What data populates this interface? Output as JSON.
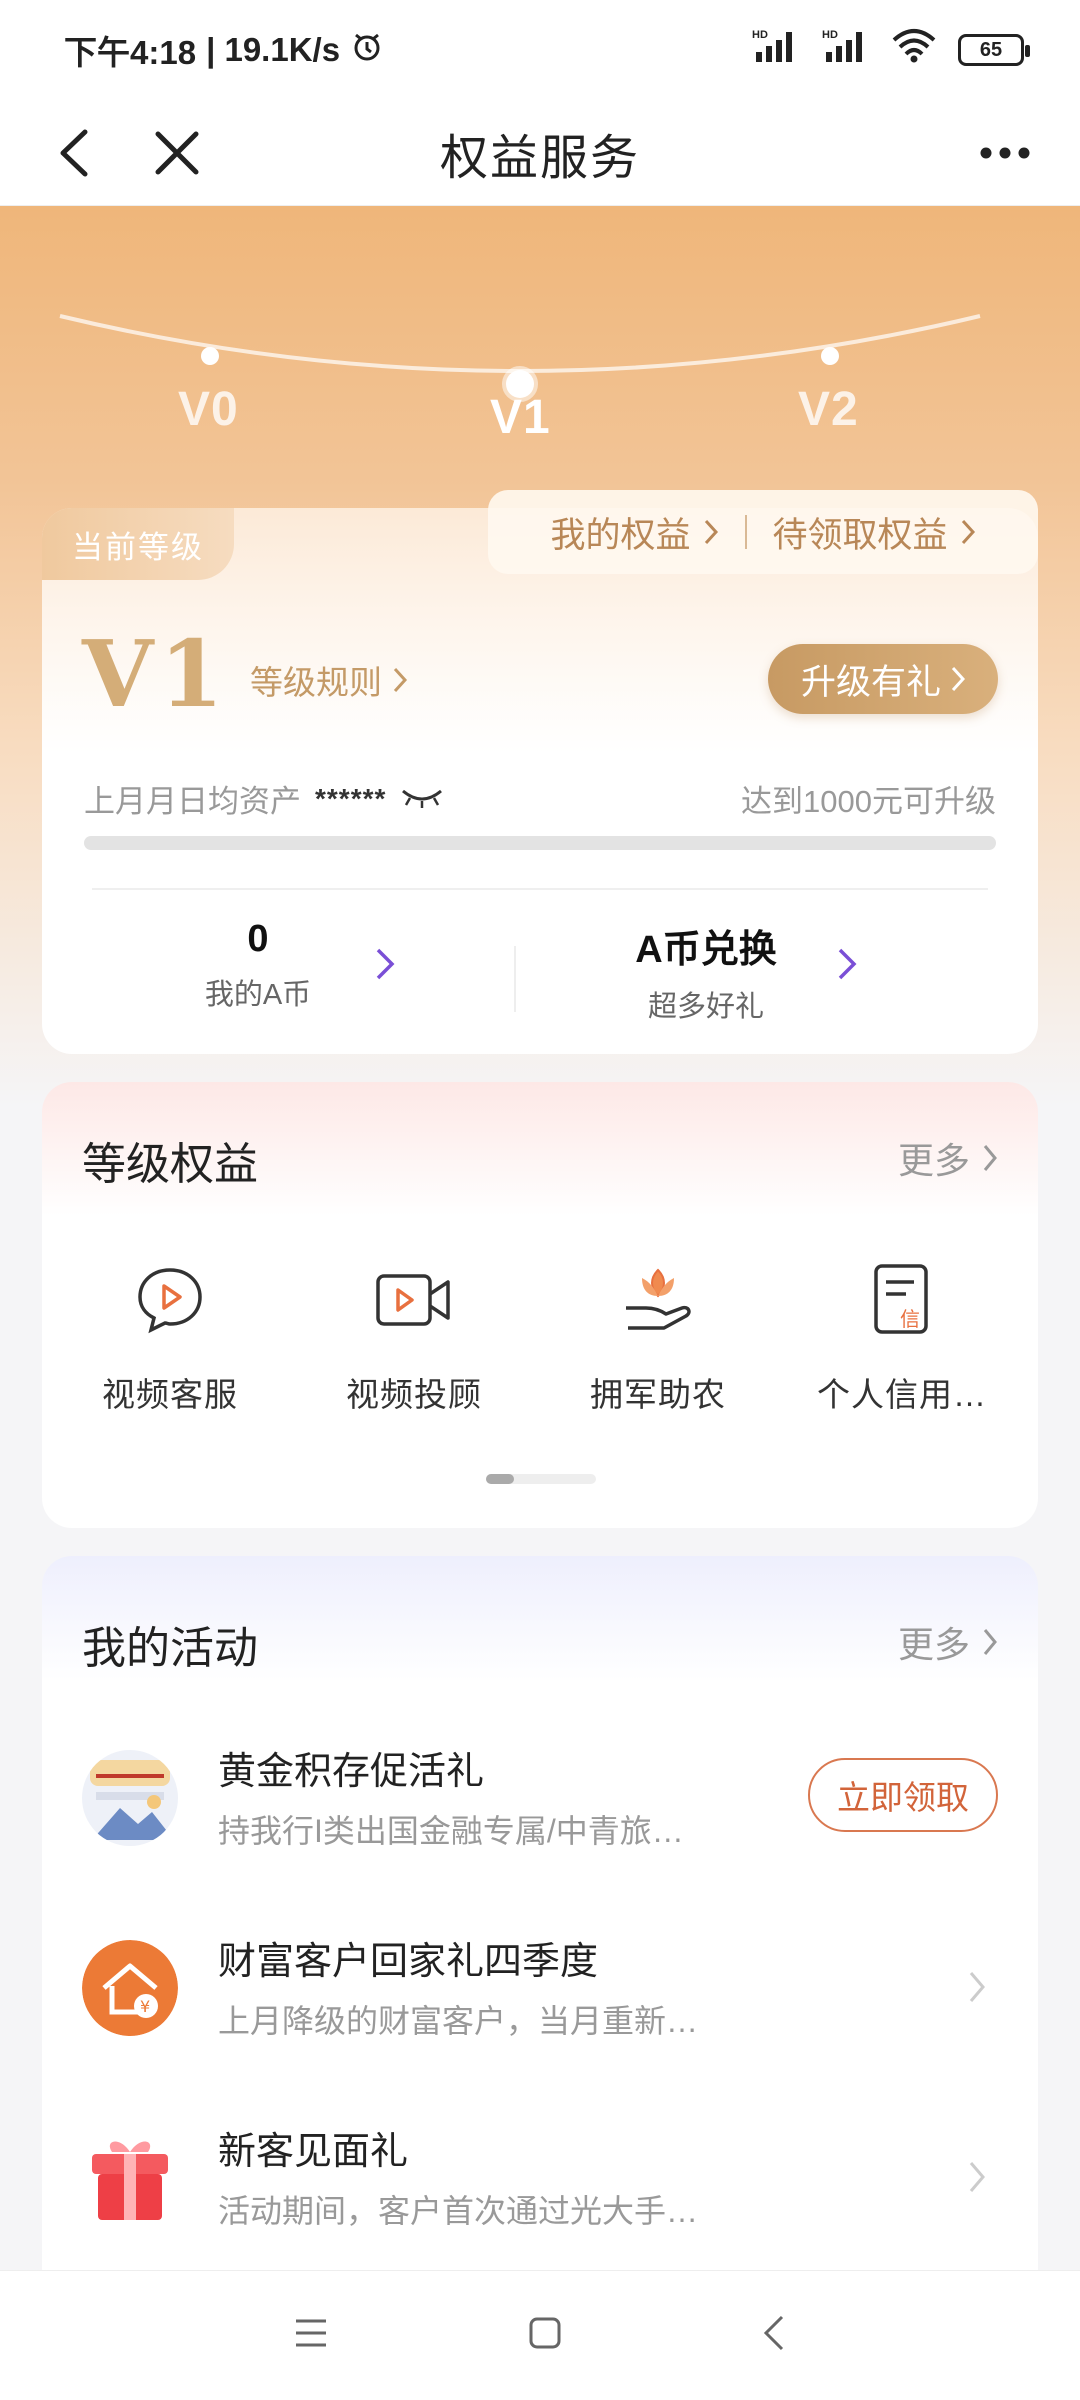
{
  "status_bar": {
    "time": "下午4:18",
    "speed": "| 19.1K/s",
    "signal1": "HD",
    "signal2": "HD",
    "battery": "65"
  },
  "nav": {
    "title": "权益服务"
  },
  "hero": {
    "levels": [
      "V0",
      "V1",
      "V2"
    ]
  },
  "level_card": {
    "current_tag": "当前等级",
    "my_benefits": "我的权益",
    "pending_benefits": "待领取权益",
    "level": "V1",
    "rules": "等级规则",
    "upgrade_button": "升级有礼",
    "asset_label": "上月月日均资产",
    "asset_value": "******",
    "upgrade_hint": "达到1000元可升级",
    "progress": 0,
    "coins_value": "0",
    "coins_label": "我的A币",
    "exchange_title": "A币兑换",
    "exchange_sub": "超多好礼"
  },
  "grade_benefits": {
    "title": "等级权益",
    "more": "更多",
    "items": [
      {
        "label": "视频客服",
        "icon": "chat-play-icon"
      },
      {
        "label": "视频投顾",
        "icon": "video-camera-icon"
      },
      {
        "label": "拥军助农",
        "icon": "lotus-hand-icon"
      },
      {
        "label": "个人信用…",
        "icon": "credit-document-icon"
      }
    ]
  },
  "activities": {
    "title": "我的活动",
    "more": "更多",
    "items": [
      {
        "title": "黄金积存促活礼",
        "desc": "持我行I类出国金融专属/中青旅…",
        "action": "立即领取"
      },
      {
        "title": "财富客户回家礼四季度",
        "desc": "上月降级的财富客户，当月重新…",
        "action": ""
      },
      {
        "title": "新客见面礼",
        "desc": "活动期间，客户首次通过光大手…",
        "action": ""
      }
    ]
  },
  "colors": {
    "accent_gold": "#c79a63",
    "hero_orange": "#efb67a",
    "claim_orange": "#d2643a",
    "purple_arrow": "#7a4fd6"
  }
}
